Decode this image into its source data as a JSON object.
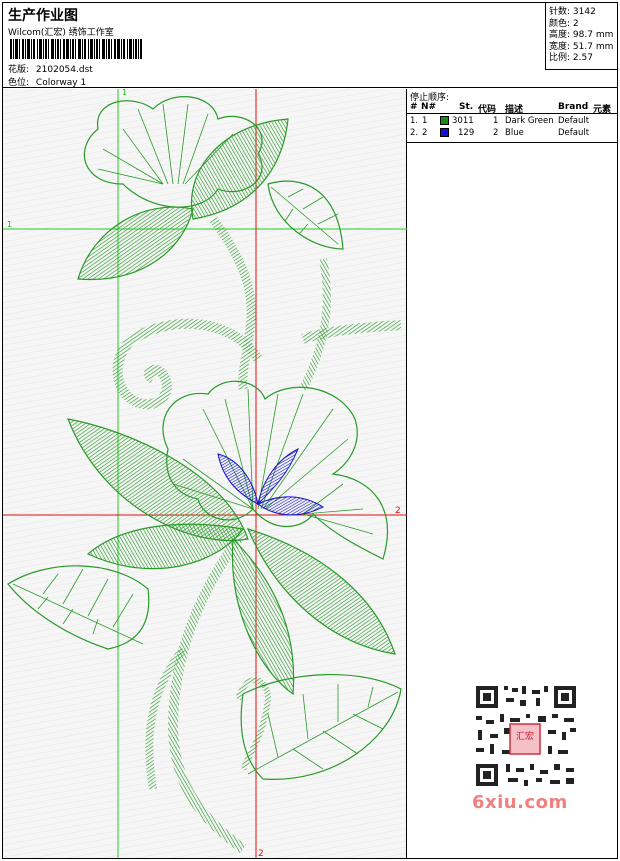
{
  "header": {
    "title": "生产作业图",
    "studio": "Wilcom(汇宏) 绣饰工作室",
    "design_file_label": "花版:",
    "design_file": "2102054.dst",
    "colorway_label": "色位:",
    "colorway": "Colorway 1"
  },
  "stats": [
    {
      "label": "针数:",
      "value": "3142"
    },
    {
      "label": "颜色:",
      "value": "2"
    },
    {
      "label": "高度:",
      "value": "98.7 mm"
    },
    {
      "label": "宽度:",
      "value": "51.7 mm"
    },
    {
      "label": "比例:",
      "value": "2.57"
    }
  ],
  "stop_sequence": {
    "title": "停止顺序:",
    "columns": [
      "#",
      "N#",
      "St.",
      "代码",
      "描述",
      "Brand",
      "元素"
    ],
    "rows": [
      {
        "index": "1.",
        "needle": "1",
        "stitches": "3011",
        "code": "1",
        "description": "Dark Green",
        "brand": "Default",
        "color": "#1a8a1a"
      },
      {
        "index": "2.",
        "needle": "2",
        "stitches": "129",
        "code": "2",
        "description": "Blue",
        "brand": "Default",
        "color": "#1010d0"
      }
    ]
  },
  "crosshairs": {
    "mark1": "1",
    "mark2": "2"
  },
  "colors": {
    "green_thread": "#2a9a2a",
    "blue_thread": "#1515c8",
    "crosshair_green": "#22cc22",
    "crosshair_red": "#e01010"
  },
  "watermark": {
    "text": "6xiu.com",
    "stamp": "汇宏"
  }
}
